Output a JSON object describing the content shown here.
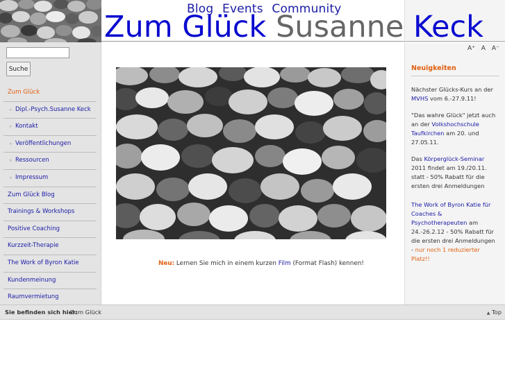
{
  "header": {
    "nav": [
      "Blog",
      "Events",
      "Community"
    ],
    "title_part1": "Zum Glück",
    "title_part2": "Susanne",
    "title_part3": "Keck"
  },
  "search": {
    "value": "",
    "button_label": "Suche"
  },
  "menu": [
    {
      "label": "Zum Glück",
      "level": 1,
      "active": true
    },
    {
      "label": "Dipl.-Psych.Susanne Keck",
      "level": 2
    },
    {
      "label": "Kontakt",
      "level": 2
    },
    {
      "label": "Veröffentlichungen",
      "level": 2
    },
    {
      "label": "Ressourcen",
      "level": 2
    },
    {
      "label": "Impressum",
      "level": 2
    },
    {
      "label": "Zum Glück Blog",
      "level": 1
    },
    {
      "label": "Trainings & Workshops",
      "level": 1
    },
    {
      "label": "Positive Coaching",
      "level": 1
    },
    {
      "label": "Kurzzeit-Therapie",
      "level": 1
    },
    {
      "label": "The Work of Byron Katie",
      "level": 1
    },
    {
      "label": "Kundenmeinung",
      "level": 1
    },
    {
      "label": "Raumvermietung",
      "level": 1
    }
  ],
  "main": {
    "neu_label": "Neu:",
    "neu_text1": "Lernen Sie mich in einem kurzen",
    "neu_link": "Film",
    "neu_text2": "(Format Flash) kennen!"
  },
  "fontsize": {
    "larger": "A⁺",
    "normal": "A",
    "smaller": "A⁻"
  },
  "news": {
    "title": "Neuigkeiten",
    "p1_text1": "Nächster Glücks-Kurs an der",
    "p1_link": "MVHS",
    "p1_text2": "vom 6.-27.9.11!",
    "p2_text1": "\"Das wahre Glück\" jetzt auch an der",
    "p2_link": "Volkshochschule Taufkirchen",
    "p2_text2": "am 20. und 27.05.11.",
    "p3_text1": "Das",
    "p3_link": "Körperglück-Seminar",
    "p3_text2": "2011 findet am 19./20.11. statt - 50% Rabatt für die ersten drei Anmeldungen",
    "p4_link": "The Work of Byron Katie für Coaches & Psychotherapeuten",
    "p4_text": "am 24.-26.2.12 - 50% Rabatt für die ersten drei Anmeldungen -",
    "p4_highlight": "nur noch 1 reduzierter Platz!!"
  },
  "footer": {
    "breadcrumb_label": "Sie befinden sich hier:",
    "breadcrumb_item": "Zum Glück",
    "top_link": "Top",
    "top_icon": "up-arrow-icon"
  },
  "colors": {
    "link": "#1a1aa6",
    "accent": "#e06010",
    "title_blue": "#0a0ad0",
    "sidebar_bg": "#e4e4e4"
  }
}
